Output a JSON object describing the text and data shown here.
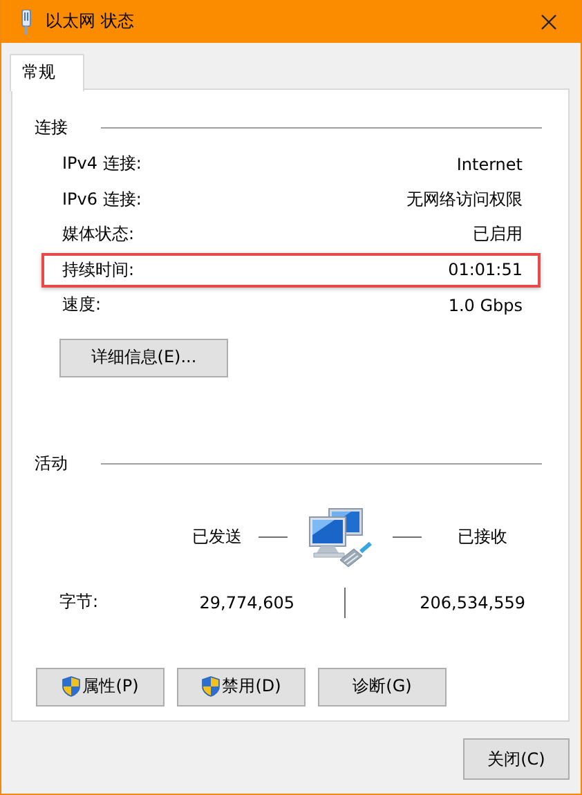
{
  "window": {
    "title": "以太网 状态"
  },
  "tabs": [
    {
      "label": "常规",
      "selected": true
    }
  ],
  "connection": {
    "heading": "连接",
    "rows": [
      {
        "label": "IPv4 连接:",
        "value": "Internet",
        "highlighted": false
      },
      {
        "label": "IPv6 连接:",
        "value": "无网络访问权限",
        "highlighted": false
      },
      {
        "label": "媒体状态:",
        "value": "已启用",
        "highlighted": false
      },
      {
        "label": "持续时间:",
        "value": "01:01:51",
        "highlighted": true
      },
      {
        "label": "速度:",
        "value": "1.0 Gbps",
        "highlighted": false
      }
    ]
  },
  "details_button": "详细信息(E)...",
  "activity": {
    "heading": "活动",
    "sent_label": "已发送",
    "received_label": "已接收",
    "rows": [
      {
        "label": "字节:",
        "sent": "29,774,605",
        "received": "206,534,559"
      }
    ]
  },
  "buttons": [
    {
      "label": "属性(P)",
      "shield": true
    },
    {
      "label": "禁用(D)",
      "shield": true
    },
    {
      "label": "诊断(G)",
      "shield": false
    }
  ],
  "close_button": "关闭(C)"
}
